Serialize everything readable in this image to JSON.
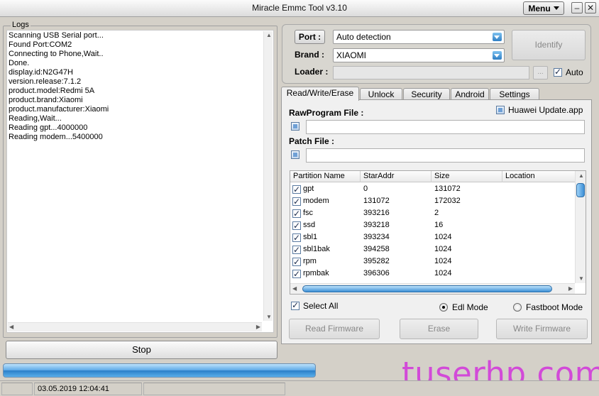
{
  "window": {
    "title": "Miracle Emmc Tool  v3.10",
    "menu_label": "Menu",
    "minimize": "–",
    "close": "✕"
  },
  "logs": {
    "legend": "Logs",
    "lines": [
      "Scanning USB Serial port...",
      "Found Port:COM2",
      "Connecting to Phone,Wait..",
      "Done.",
      "display.id:N2G47H",
      "version.release:7.1.2",
      "product.model:Redmi 5A",
      "product.brand:Xiaomi",
      "product.manufacturer:Xiaomi",
      "Reading,Wait...",
      "Reading  gpt...4000000",
      "Reading  modem...5400000"
    ]
  },
  "stop_label": "Stop",
  "connection": {
    "port_label": "Port :",
    "port_value": "Auto detection",
    "brand_label": "Brand :",
    "brand_value": "XIAOMI",
    "loader_label": "Loader :",
    "browse_label": "...",
    "auto_label": "Auto",
    "auto_checked": true,
    "identify_label": "Identify"
  },
  "tabs": [
    "Read/Write/Erase",
    "Unlock",
    "Security",
    "Android",
    "Settings"
  ],
  "rwe": {
    "rawprogram_label": "RawProgram File :",
    "patch_label": "Patch File :",
    "huawei_label": "Huawei Update.app",
    "columns": [
      "Partition Name",
      "StarAddr",
      "Size",
      "Location"
    ],
    "rows": [
      {
        "name": "gpt",
        "start": "0",
        "size": "131072",
        "location": ""
      },
      {
        "name": "modem",
        "start": "131072",
        "size": "172032",
        "location": ""
      },
      {
        "name": "fsc",
        "start": "393216",
        "size": "2",
        "location": ""
      },
      {
        "name": "ssd",
        "start": "393218",
        "size": "16",
        "location": ""
      },
      {
        "name": "sbl1",
        "start": "393234",
        "size": "1024",
        "location": ""
      },
      {
        "name": "sbl1bak",
        "start": "394258",
        "size": "1024",
        "location": ""
      },
      {
        "name": "rpm",
        "start": "395282",
        "size": "1024",
        "location": ""
      },
      {
        "name": "rpmbak",
        "start": "396306",
        "size": "1024",
        "location": ""
      }
    ],
    "select_all_label": "Select All",
    "edl_label": "Edl Mode",
    "fastboot_label": "Fastboot Mode",
    "mode_selected": "Edl Mode",
    "read_label": "Read Firmware",
    "erase_label": "Erase",
    "write_label": "Write Firmware"
  },
  "progress_fraction": 0.52,
  "status": {
    "datetime": "03.05.2019 12:04:41"
  },
  "watermark": "tuserhp.com"
}
